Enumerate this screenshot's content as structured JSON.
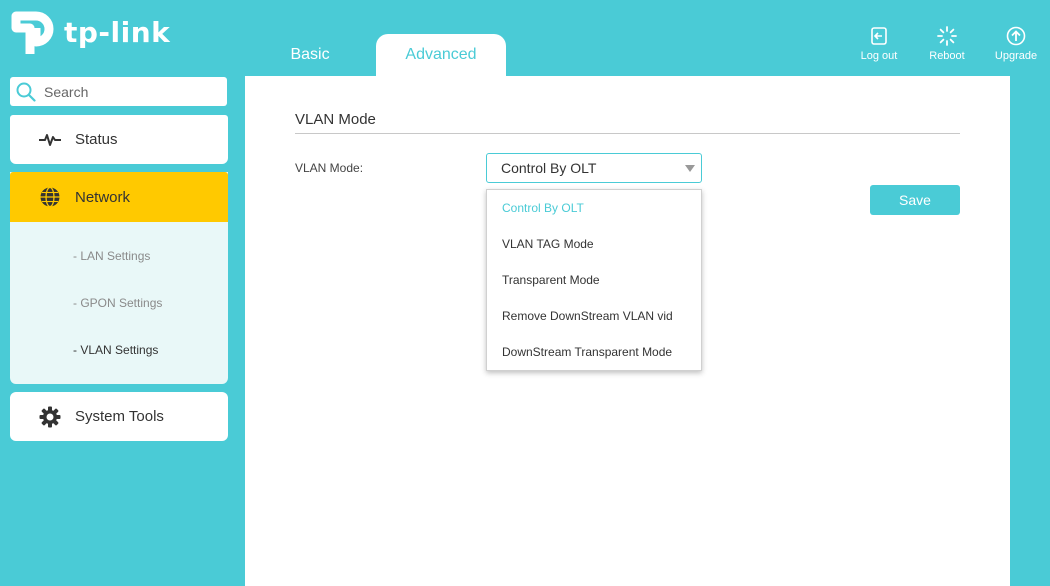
{
  "brand": {
    "name": "tp-link"
  },
  "tabs": [
    {
      "label": "Basic"
    },
    {
      "label": "Advanced"
    }
  ],
  "header_actions": {
    "logout": "Log out",
    "reboot": "Reboot",
    "upgrade": "Upgrade"
  },
  "search": {
    "placeholder": "Search"
  },
  "sidebar": {
    "status": "Status",
    "network": "Network",
    "network_subitems": [
      "- LAN Settings",
      "- GPON Settings",
      "- VLAN Settings"
    ],
    "active_subitem": "- VLAN Settings",
    "system_tools": "System Tools"
  },
  "main": {
    "section_title": "VLAN Mode",
    "vlan_mode_label": "VLAN Mode:",
    "vlan_mode_value": "Control By OLT",
    "vlan_mode_options": [
      "Control By OLT",
      "VLAN TAG Mode",
      "Transparent Mode",
      "Remove DownStream VLAN vid",
      "DownStream Transparent Mode"
    ],
    "save_label": "Save"
  },
  "colors": {
    "accent": "#4acbd6",
    "highlight": "#ffc900",
    "submenu_bg": "#e9f8f8"
  }
}
